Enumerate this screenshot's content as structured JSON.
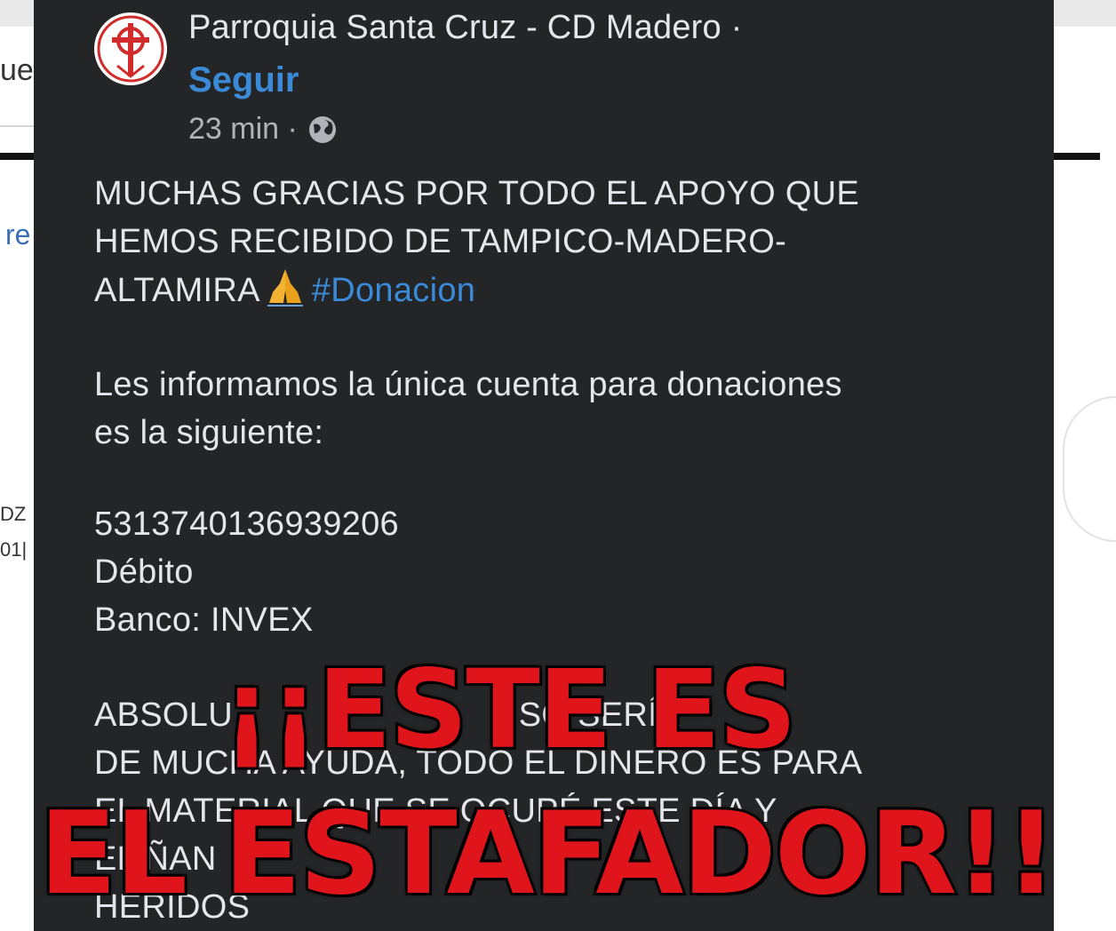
{
  "background": {
    "fragment_top": "ue",
    "fragment_link": "re",
    "fragment_mid1": "DZ",
    "fragment_mid2": "01|"
  },
  "post": {
    "page_name": "Parroquia Santa Cruz - CD Madero ·",
    "follow_label": "Seguir",
    "time": "23 min ·",
    "privacy_icon": "globe-icon",
    "lines": {
      "l1": "MUCHAS GRACIAS POR TODO EL APOYO QUE",
      "l2": "HEMOS RECIBIDO DE TAMPICO-MADERO-",
      "l3_text": "ALTAMIRA",
      "l3_emoji": "praying-hands-icon",
      "l3_hashtag": "#Donacion",
      "l4": "Les informamos la única cuenta para donaciones",
      "l5": "es la siguiente:",
      "account_number": "5313740136939206",
      "account_type": "Débito",
      "bank": "Banco: INVEX",
      "l9": "ABSOLU",
      "l9b": "TODO",
      "l9c": "ES",
      "l9d": "SO SERÍA",
      "l10": "DE MUCHA AYUDA, TODO EL DINERO ES PARA",
      "l11": "EL MATERIAL QUE SE OCUPÉ ESTE DÍA Y",
      "l12": "EL",
      "l12b": "ÑAN",
      "l13": "HERIDOS"
    }
  },
  "overlay": {
    "line1": "¡¡ESTE ES",
    "line2": "EL ESTAFADOR!!"
  },
  "colors": {
    "panel": "#242526",
    "link": "#3b8ad8",
    "overlay_red": "#e0141b"
  }
}
